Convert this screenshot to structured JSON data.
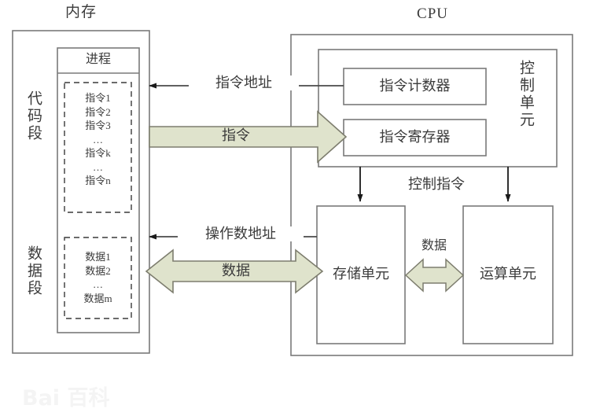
{
  "diagram": {
    "memory": {
      "title": "内存",
      "code_segment_label": "代码段",
      "data_segment_label": "数据段",
      "process_label": "进程",
      "code_items": "指令1\n指令2\n指令3\n…\n指令k\n…\n指令n",
      "data_items": "数据1\n数据2\n…\n数据m"
    },
    "cpu": {
      "title": "CPU",
      "control_unit_label": "控制单元",
      "program_counter_label": "指令计数器",
      "instruction_register_label": "指令寄存器",
      "storage_unit_label": "存储单元",
      "arithmetic_unit_label": "运算单元"
    },
    "connections": {
      "instruction_address": "指令地址",
      "instruction": "指令",
      "control_instruction": "控制指令",
      "operand_address": "操作数地址",
      "data_bus": "数据",
      "internal_data": "数据"
    },
    "watermark": "Bai 百科",
    "colors": {
      "arrow_fill": "#dfe3cc",
      "arrow_stroke": "#7d7d6e",
      "box_stroke": "#7a7a7a",
      "text": "#3b3b3b",
      "line": "#4a4a4a",
      "background": "#ffffff"
    }
  }
}
